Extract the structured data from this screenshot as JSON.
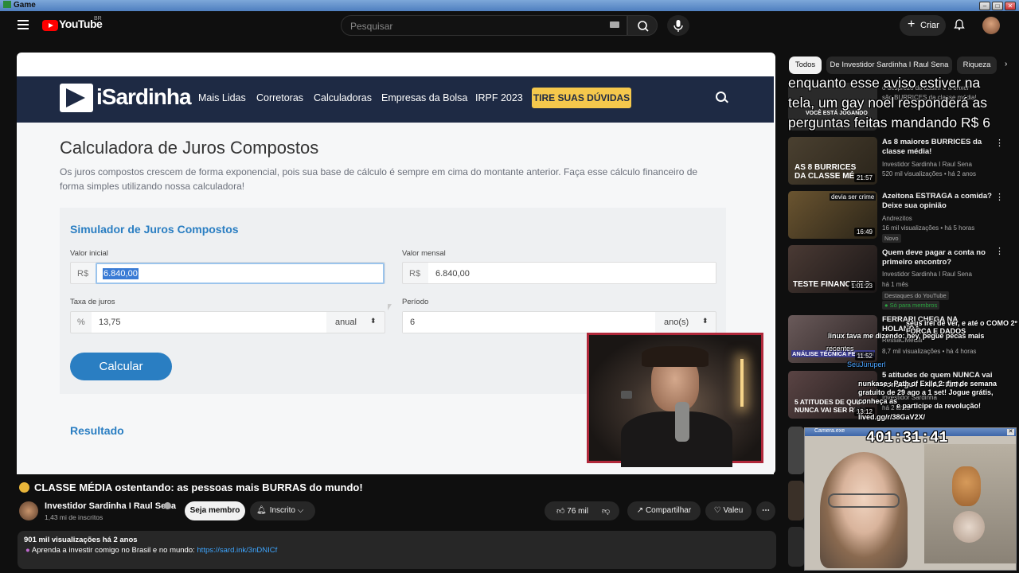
{
  "window": {
    "title": "Game",
    "btn_min": "–",
    "btn_max": "□",
    "btn_close": "✕"
  },
  "youtube": {
    "logo_text": "YouTube",
    "region": "BR",
    "search_placeholder": "Pesquisar",
    "create_label": "Criar"
  },
  "site": {
    "logo": "iSardinha",
    "nav": [
      "Mais Lidas",
      "Corretoras",
      "Calculadoras",
      "Empresas da Bolsa",
      "IRPF 2023"
    ],
    "cta": "TIRE SUAS DÚVIDAS",
    "page_title": "Calculadora de Juros Compostos",
    "lead": "Os juros compostos crescem de forma exponencial, pois sua base de cálculo é sempre em cima do montante anterior. Faça esse cálculo financeiro de forma simples utilizando nossa calculadora!",
    "simulator_title": "Simulador de Juros Compostos",
    "valor_inicial_label": "Valor inicial",
    "valor_inicial_prefix": "R$",
    "valor_inicial_value": "6.840,00",
    "valor_mensal_label": "Valor mensal",
    "valor_mensal_prefix": "R$",
    "valor_mensal_value": "6.840,00",
    "taxa_label": "Taxa de juros",
    "taxa_prefix": "%",
    "taxa_value": "13,75",
    "taxa_period": "anual",
    "periodo_label": "Período",
    "periodo_value": "6",
    "periodo_unit": "ano(s)",
    "calc_button": "Calcular",
    "result_title": "Resultado"
  },
  "video": {
    "title": "CLASSE MÉDIA ostentando: as pessoas mais BURRAS do mundo!",
    "channel": "Investidor Sardinha I Raul Sena",
    "subscribers": "1,43 mi de inscritos",
    "join": "Seja membro",
    "subscribed": "Inscrito",
    "likes": "76 mil",
    "share": "Compartilhar",
    "thanks": "Valeu",
    "views_date": "901 mil visualizações  há 2 anos",
    "desc_text": "Aprenda a investir comigo no Brasil e no mundo: ",
    "desc_link": "https://sard.ink/3nDNICf"
  },
  "chips": [
    "Todos",
    "De Investidor Sardinha I Raul Sena",
    "Riqueza"
  ],
  "overlay_text": [
    "enquanto esse aviso estiver na",
    "tela, um gay noel responderá as",
    "perguntas feitas mandando R$ 6"
  ],
  "overlay_behind": [
    "o desprezo da assim é a enxer",
    "são BURRICES da classe média!",
    "VOCÊ ESTÁ JOGANDO"
  ],
  "recommendations": [
    {
      "title": "As 8 maiores BURRICES da classe média!",
      "channel": "Investidor Sardinha I Raul Sena",
      "meta": "520 mil visualizações • há 2 anos",
      "duration": "21:57",
      "thumb_text": "AS 8 BURRICES DA CLASSE MÉ",
      "thumb_color": "#3a3424"
    },
    {
      "title": "Azeitona ESTRAGA a comida? Deixe sua opinião",
      "channel": "Andrezitos",
      "meta": "16 mil visualizações • há 5 horas",
      "badge": "Novo",
      "duration": "16:49",
      "thumb_text": "devia ser crime",
      "thumb_color": "#5a4a2a"
    },
    {
      "title": "Quem deve pagar a conta no primeiro encontro?",
      "channel": "Investidor Sardinha I Raul Sena",
      "meta": "há 1 mês",
      "badge": "Destaques do YouTube",
      "members": "Só para membros",
      "duration": "1:01:23",
      "thumb_text": "TESTE FINANCEIRO",
      "thumb_color": "#2e2a2a"
    },
    {
      "title": "FERRARI CHEGA NA HOLANDA",
      "channel": "RessaCMedia",
      "meta": "8,7 mil visualizações • há 4 horas",
      "duration": "11:52",
      "thumb_text": "ANÁLISE TÉCNICA FERRARI",
      "thumb_color": "#4a3a3a"
    },
    {
      "title": "5 atitudes de quem NUNCA vai conseguir FICAR RICO!",
      "channel": "Investidor Sardinha",
      "meta": "há 2 anos",
      "duration": "13:12",
      "thumb_text": "5 ATITUDES DE QUEM NUNCA VAI SER RICO",
      "thumb_color": "#3a3232"
    }
  ],
  "chat": [
    "seus irei de ver, e até o COMO 2º FORÇA E DADOS",
    "linux tava me dizendo:   hey, pegue pecas mais",
    "recentes",
    "SeuJuruperl",
    "nunkase : Path of Exile 2: fim de semana gratuito de 29 ago a 1 set! Jogue grátis, conheça as",
    "lived.gg/r/38GaV2X/",
    "e participe da revolução!"
  ],
  "webcam": {
    "title": "Camera.exe",
    "timer": "401:31:41"
  }
}
